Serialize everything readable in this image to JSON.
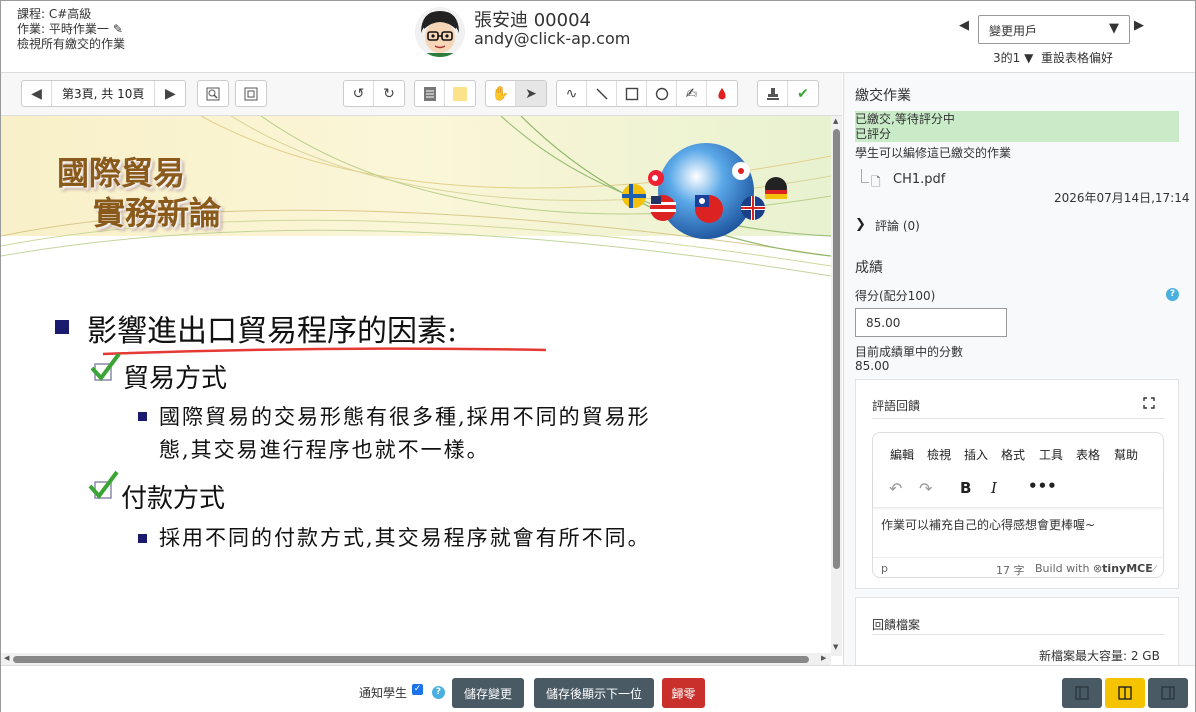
{
  "header": {
    "course_label": "課程: C#高級",
    "assignment_label": "作業: 平時作業一",
    "view_all_link": "檢視所有繳交的作業",
    "user_name": "張安迪 00004",
    "user_email": "andy@click-ap.com",
    "change_user_label": "變更用戶",
    "user_count": "3的1",
    "reset_prefs_link": "重設表格偏好"
  },
  "toolbar": {
    "page_indicator": "第3頁, 共 10頁"
  },
  "slide": {
    "title_line1": "國際貿易",
    "title_line2": "實務新論",
    "heading": "影響進出口貿易程序的因素:",
    "item1_title": "貿易方式",
    "item1_text_line1": "國際貿易的交易形態有很多種,採用不同的貿易形",
    "item1_text_line2": "態,其交易進行程序也就不一樣。",
    "item2_title": "付款方式",
    "item2_text": "採用不同的付款方式,其交易程序就會有所不同。"
  },
  "panel": {
    "submission_title": "繳交作業",
    "status_submitted": "已繳交,等待評分中",
    "status_graded": "已評分",
    "edit_note": "學生可以編修這已繳交的作業",
    "file_name": "CH1.pdf",
    "submitted_time": "2026年07月14日,17:14",
    "comments_label": "評論 (0)",
    "grade_title": "成績",
    "score_label": "得分(配分100)",
    "score_value": "85.00",
    "current_grade_label": "目前成績單中的分數",
    "current_grade_value": "85.00",
    "feedback_title": "評語回饋",
    "editor_menu": [
      "編輯",
      "檢視",
      "插入",
      "格式",
      "工具",
      "表格",
      "幫助"
    ],
    "feedback_text": "作業可以補充自己的心得感想會更棒喔~",
    "editor_path": "p",
    "word_count": "17 字",
    "build_with": "Build with",
    "tinymce_brand": "tinyMCE",
    "feedback_files_title": "回饋檔案",
    "max_size_label": "新檔案最大容量: 2 GB"
  },
  "footer": {
    "notify_label": "通知學生",
    "notify_checked": true,
    "save_label": "儲存變更",
    "save_next_label": "儲存後顯示下一位",
    "reset_label": "歸零"
  },
  "colors": {
    "status_bg": "#c9ebc8",
    "primary_btn": "#4a5a65",
    "danger_btn": "#c9302c",
    "active_layout": "#f5c300",
    "annotation_red": "#e53935",
    "check_green": "#3aa535",
    "bullet_navy": "#1a1a6e"
  },
  "icons": [
    "pencil-icon",
    "prev-user-icon",
    "next-user-icon",
    "filter-icon",
    "prev-page-icon",
    "next-page-icon",
    "search-comments-icon",
    "expand-icon",
    "rotate-left-icon",
    "rotate-right-icon",
    "comment-icon",
    "highlight-icon",
    "hand-icon",
    "select-icon",
    "pen-icon",
    "line-icon",
    "rectangle-icon",
    "oval-icon",
    "highlighter-icon",
    "color-drop-icon",
    "stamp-icon",
    "checkmark-icon",
    "file-pdf-icon",
    "fullscreen-icon",
    "undo-icon",
    "redo-icon",
    "bold-icon",
    "italic-icon",
    "more-icon",
    "help-icon"
  ]
}
